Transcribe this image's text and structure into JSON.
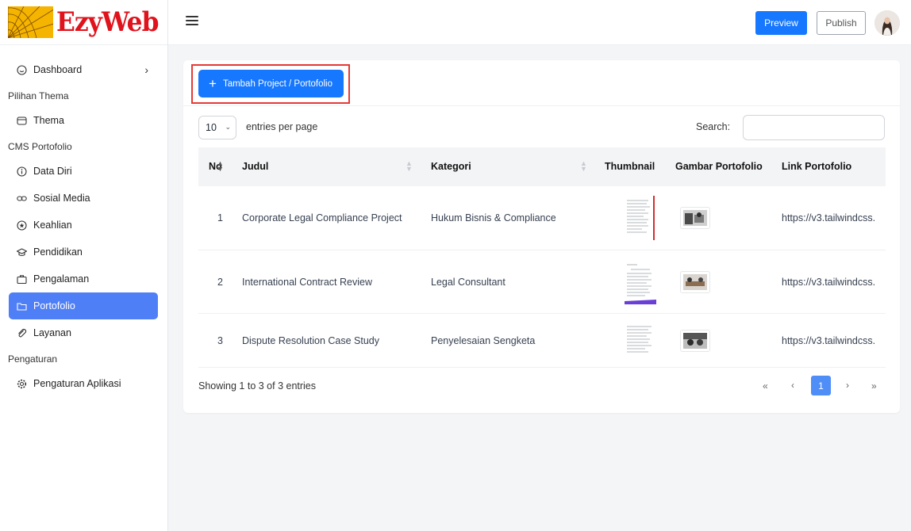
{
  "brand": {
    "name": "EzyWeb"
  },
  "sidebar": {
    "items": [
      {
        "label": "Dashboard",
        "icon": "smile-icon"
      },
      {
        "section": "Pilihan Thema"
      },
      {
        "label": "Thema",
        "icon": "palette-icon"
      },
      {
        "section": "CMS Portofolio"
      },
      {
        "label": "Data Diri",
        "icon": "info-icon"
      },
      {
        "label": "Sosial Media",
        "icon": "link-icon"
      },
      {
        "label": "Keahlian",
        "icon": "star-icon"
      },
      {
        "label": "Pendidikan",
        "icon": "graduation-cap-icon"
      },
      {
        "label": "Pengalaman",
        "icon": "briefcase-icon"
      },
      {
        "label": "Portofolio",
        "icon": "folder-icon",
        "active": true
      },
      {
        "label": "Layanan",
        "icon": "attachment-icon"
      },
      {
        "section": "Pengaturan"
      },
      {
        "label": "Pengaturan Aplikasi",
        "icon": "gear-icon"
      }
    ]
  },
  "topbar": {
    "preview_label": "Preview",
    "publish_label": "Publish"
  },
  "main": {
    "add_button_label": "Tambah Project / Portofolio",
    "per_page_value": "10",
    "per_page_label": "entries per page",
    "search_label": "Search:",
    "search_value": "",
    "columns": [
      "No",
      "Judul",
      "Kategori",
      "Thumbnail",
      "Gambar Portofolio",
      "Link Portofolio"
    ],
    "rows": [
      {
        "no": "1",
        "judul": "Corporate Legal Compliance Project",
        "kategori": "Hukum Bisnis & Compliance",
        "link": "https://v3.tailwindcss."
      },
      {
        "no": "2",
        "judul": "International Contract Review",
        "kategori": "Legal Consultant",
        "link": "https://v3.tailwindcss."
      },
      {
        "no": "3",
        "judul": "Dispute Resolution Case Study",
        "kategori": "Penyelesaian Sengketa",
        "link": "https://v3.tailwindcss."
      }
    ],
    "showing_text": "Showing 1 to 3 of 3 entries",
    "pager": {
      "first": "«",
      "prev": "‹",
      "current": "1",
      "next": "›",
      "last": "»"
    }
  },
  "colors": {
    "primary": "#1677ff",
    "active_nav": "#4f7ff7",
    "highlight": "#e53935",
    "logo_red": "#e0121b",
    "logo_yellow": "#f5b400"
  }
}
